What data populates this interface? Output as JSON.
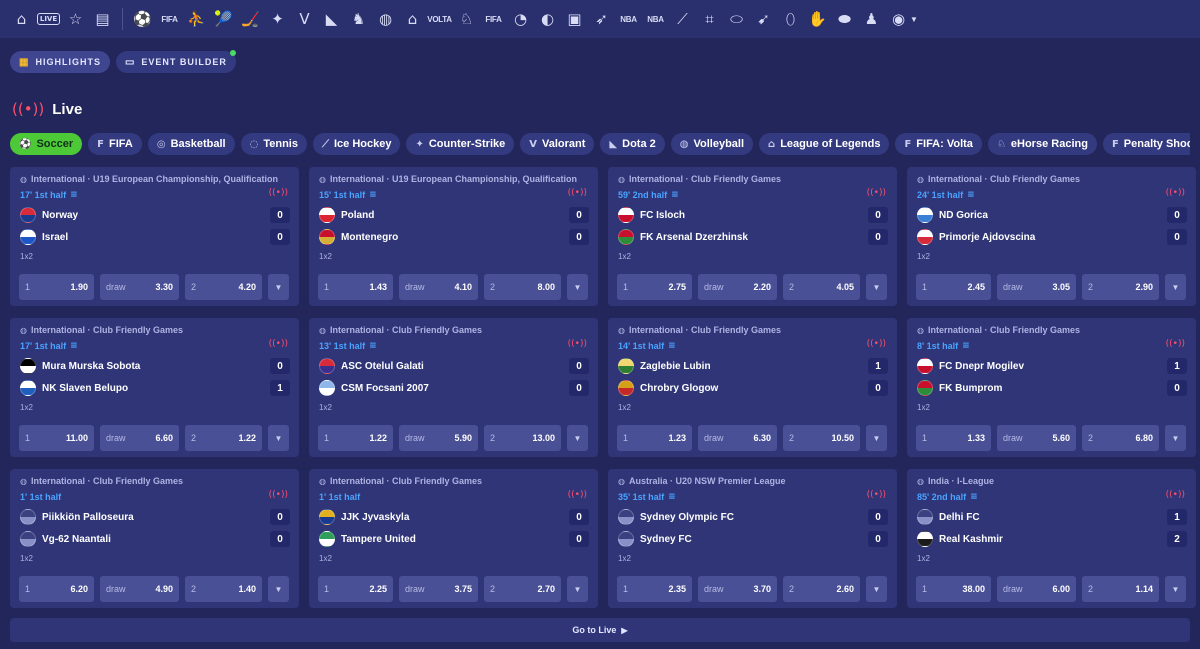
{
  "topbar": {
    "icons": [
      "home-icon",
      "live-icon",
      "star-icon",
      "betslip-icon"
    ],
    "live_label": "LIVE",
    "sports": [
      {
        "name": "soccer-icon",
        "glyph": "⚽",
        "text": ""
      },
      {
        "name": "fifa-icon",
        "glyph": "",
        "text": "FIFA"
      },
      {
        "name": "basketball-icon",
        "glyph": "⛹",
        "text": ""
      },
      {
        "name": "tennis-icon",
        "glyph": "🎾",
        "text": ""
      },
      {
        "name": "hockey-icon",
        "glyph": "🏒",
        "text": ""
      },
      {
        "name": "counter-strike-icon",
        "glyph": "✦",
        "text": ""
      },
      {
        "name": "valorant-icon",
        "glyph": "V",
        "text": ""
      },
      {
        "name": "dota-icon",
        "glyph": "◣",
        "text": ""
      },
      {
        "name": "chess-icon",
        "glyph": "♞",
        "text": ""
      },
      {
        "name": "volleyball-icon",
        "glyph": "◍",
        "text": ""
      },
      {
        "name": "lol-icon",
        "glyph": "⌂",
        "text": ""
      },
      {
        "name": "fifa-volta-icon",
        "glyph": "",
        "text": "VOLTA"
      },
      {
        "name": "horse-racing-icon",
        "glyph": "♘",
        "text": ""
      },
      {
        "name": "penalty-fifa-icon",
        "glyph": "",
        "text": "FIFA"
      },
      {
        "name": "cricket-icon",
        "glyph": "◔",
        "text": ""
      },
      {
        "name": "pingpong-icon",
        "glyph": "◐",
        "text": ""
      },
      {
        "name": "cards-icon",
        "glyph": "▣",
        "text": ""
      },
      {
        "name": "sprint-icon",
        "glyph": "➶",
        "text": ""
      },
      {
        "name": "nba-icon",
        "glyph": "",
        "text": "NBA"
      },
      {
        "name": "nba2-icon",
        "glyph": "",
        "text": "NBA"
      },
      {
        "name": "bat-icon",
        "glyph": "⟋",
        "text": ""
      },
      {
        "name": "bandage-icon",
        "glyph": "⌗",
        "text": ""
      },
      {
        "name": "rugby-icon",
        "glyph": "⬭",
        "text": ""
      },
      {
        "name": "badminton-icon",
        "glyph": "➹",
        "text": ""
      },
      {
        "name": "australian-football-icon",
        "glyph": "⬯",
        "text": ""
      },
      {
        "name": "handball-icon",
        "glyph": "✋",
        "text": ""
      },
      {
        "name": "american-football-icon",
        "glyph": "⬬",
        "text": ""
      },
      {
        "name": "kabaddi-icon",
        "glyph": "♟",
        "text": ""
      },
      {
        "name": "more-sports-icon",
        "glyph": "◉",
        "text": ""
      }
    ]
  },
  "subnav": {
    "highlights": "HIGHLIGHTS",
    "event_builder": "EVENT BUILDER"
  },
  "live": {
    "title": "Live"
  },
  "tabs": [
    {
      "label": "Soccer",
      "icon": "soccer-icon",
      "glyph": "⚽",
      "active": true
    },
    {
      "label": "FIFA",
      "icon": "fifa-icon",
      "glyph": "F",
      "active": false
    },
    {
      "label": "Basketball",
      "icon": "basketball-icon",
      "glyph": "◎",
      "active": false
    },
    {
      "label": "Tennis",
      "icon": "tennis-icon",
      "glyph": "◌",
      "active": false
    },
    {
      "label": "Ice Hockey",
      "icon": "hockey-icon",
      "glyph": "⟋",
      "active": false
    },
    {
      "label": "Counter-Strike",
      "icon": "counter-strike-icon",
      "glyph": "✦",
      "active": false
    },
    {
      "label": "Valorant",
      "icon": "valorant-icon",
      "glyph": "V",
      "active": false
    },
    {
      "label": "Dota 2",
      "icon": "dota-icon",
      "glyph": "◣",
      "active": false
    },
    {
      "label": "Volleyball",
      "icon": "volleyball-icon",
      "glyph": "◍",
      "active": false
    },
    {
      "label": "League of Legends",
      "icon": "lol-icon",
      "glyph": "⌂",
      "active": false
    },
    {
      "label": "FIFA: Volta",
      "icon": "fifa-volta-icon",
      "glyph": "F",
      "active": false
    },
    {
      "label": "eHorse Racing",
      "icon": "horse-racing-icon",
      "glyph": "♘",
      "active": false
    },
    {
      "label": "Penalty Shootout",
      "icon": "penalty-shootout-icon",
      "glyph": "F",
      "active": false
    }
  ],
  "matches": [
    {
      "league": "International · U19 European Championship, Qualification",
      "time": "17' 1st half",
      "stats": true,
      "home": {
        "name": "Norway",
        "score": "0",
        "colors": [
          "#d62b3a",
          "#1a3a8f"
        ]
      },
      "away": {
        "name": "Israel",
        "score": "0",
        "colors": [
          "#ffffff",
          "#1f57c8"
        ]
      },
      "market": "1x2",
      "odds": {
        "one": "1.90",
        "draw": "3.30",
        "two": "4.20"
      }
    },
    {
      "league": "International · U19 European Championship, Qualification",
      "time": "15' 1st half",
      "stats": true,
      "home": {
        "name": "Poland",
        "score": "0",
        "colors": [
          "#ffffff",
          "#dc2433"
        ]
      },
      "away": {
        "name": "Montenegro",
        "score": "0",
        "colors": [
          "#c8102e",
          "#d4af37"
        ]
      },
      "market": "1x2",
      "odds": {
        "one": "1.43",
        "draw": "4.10",
        "two": "8.00"
      }
    },
    {
      "league": "International · Club Friendly Games",
      "time": "59' 2nd half",
      "stats": true,
      "home": {
        "name": "FC Isloch",
        "score": "0",
        "colors": [
          "#ffffff",
          "#c8102e"
        ]
      },
      "away": {
        "name": "FK Arsenal Dzerzhinsk",
        "score": "0",
        "colors": [
          "#c8102e",
          "#2e8b3a"
        ]
      },
      "market": "1x2",
      "odds": {
        "one": "2.75",
        "draw": "2.20",
        "two": "4.05"
      }
    },
    {
      "league": "International · Club Friendly Games",
      "time": "24' 1st half",
      "stats": true,
      "home": {
        "name": "ND Gorica",
        "score": "0",
        "colors": [
          "#ffffff",
          "#3a7fd5"
        ]
      },
      "away": {
        "name": "Primorje Ajdovscina",
        "score": "0",
        "colors": [
          "#ffffff",
          "#d62b3a"
        ]
      },
      "market": "1x2",
      "odds": {
        "one": "2.45",
        "draw": "3.05",
        "two": "2.90"
      }
    },
    {
      "league": "International · Club Friendly Games",
      "time": "17' 1st half",
      "stats": true,
      "home": {
        "name": "Mura Murska Sobota",
        "score": "0",
        "colors": [
          "#000000",
          "#ffffff"
        ]
      },
      "away": {
        "name": "NK Slaven Belupo",
        "score": "1",
        "colors": [
          "#ffffff",
          "#1e5fbf"
        ]
      },
      "market": "1x2",
      "odds": {
        "one": "11.00",
        "draw": "6.60",
        "two": "1.22"
      }
    },
    {
      "league": "International · Club Friendly Games",
      "time": "13' 1st half",
      "stats": true,
      "home": {
        "name": "ASC Otelul Galati",
        "score": "0",
        "colors": [
          "#d62b3a",
          "#3a2e8f"
        ]
      },
      "away": {
        "name": "CSM Focsani 2007",
        "score": "0",
        "colors": [
          "#8fb6e8",
          "#ffffff"
        ]
      },
      "market": "1x2",
      "odds": {
        "one": "1.22",
        "draw": "5.90",
        "two": "13.00"
      }
    },
    {
      "league": "International · Club Friendly Games",
      "time": "14' 1st half",
      "stats": true,
      "home": {
        "name": "Zaglebie Lubin",
        "score": "1",
        "colors": [
          "#f0d770",
          "#2e7d32"
        ]
      },
      "away": {
        "name": "Chrobry Glogow",
        "score": "0",
        "colors": [
          "#d4a017",
          "#c62828"
        ]
      },
      "market": "1x2",
      "odds": {
        "one": "1.23",
        "draw": "6.30",
        "two": "10.50"
      }
    },
    {
      "league": "International · Club Friendly Games",
      "time": "8' 1st half",
      "stats": true,
      "home": {
        "name": "FC Dnepr Mogilev",
        "score": "1",
        "colors": [
          "#ffffff",
          "#c8102e"
        ]
      },
      "away": {
        "name": "FK Bumprom",
        "score": "0",
        "colors": [
          "#c8102e",
          "#2e8b3a"
        ]
      },
      "market": "1x2",
      "odds": {
        "one": "1.33",
        "draw": "5.60",
        "two": "6.80"
      }
    },
    {
      "league": "International · Club Friendly Games",
      "time": "1' 1st half",
      "stats": false,
      "home": {
        "name": "Piikkiön Palloseura",
        "score": "0",
        "colors": [
          "#3a4080",
          "#8890c8"
        ]
      },
      "away": {
        "name": "Vg-62 Naantali",
        "score": "0",
        "colors": [
          "#3a4080",
          "#8890c8"
        ]
      },
      "market": "1x2",
      "odds": {
        "one": "6.20",
        "draw": "4.90",
        "two": "1.40"
      }
    },
    {
      "league": "International · Club Friendly Games",
      "time": "1' 1st half",
      "stats": false,
      "home": {
        "name": "JJK Jyvaskyla",
        "score": "0",
        "colors": [
          "#e0b020",
          "#1a3a8f"
        ]
      },
      "away": {
        "name": "Tampere United",
        "score": "0",
        "colors": [
          "#2e9e5a",
          "#ffffff"
        ]
      },
      "market": "1x2",
      "odds": {
        "one": "2.25",
        "draw": "3.75",
        "two": "2.70"
      }
    },
    {
      "league": "Australia · U20 NSW Premier League",
      "time": "35' 1st half",
      "stats": true,
      "home": {
        "name": "Sydney Olympic FC",
        "score": "0",
        "colors": [
          "#3a4080",
          "#8890c8"
        ]
      },
      "away": {
        "name": "Sydney FC",
        "score": "0",
        "colors": [
          "#3a4080",
          "#8890c8"
        ]
      },
      "market": "1x2",
      "odds": {
        "one": "2.35",
        "draw": "3.70",
        "two": "2.60"
      }
    },
    {
      "league": "India · I-League",
      "time": "85' 2nd half",
      "stats": true,
      "home": {
        "name": "Delhi FC",
        "score": "1",
        "colors": [
          "#3a4080",
          "#8890c8"
        ]
      },
      "away": {
        "name": "Real Kashmir",
        "score": "2",
        "colors": [
          "#ffffff",
          "#1b1b1b"
        ]
      },
      "market": "1x2",
      "odds": {
        "one": "38.00",
        "draw": "6.00",
        "two": "1.14"
      }
    }
  ],
  "labels": {
    "draw": "draw",
    "one": "1",
    "two": "2"
  },
  "footer": {
    "go_to_live": "Go to Live"
  },
  "colors": {
    "background": "#22265a",
    "card": "#2f3577",
    "accent_green": "#4dc937",
    "time_blue": "#4aa3ff",
    "live_red": "#ff4d6d"
  }
}
